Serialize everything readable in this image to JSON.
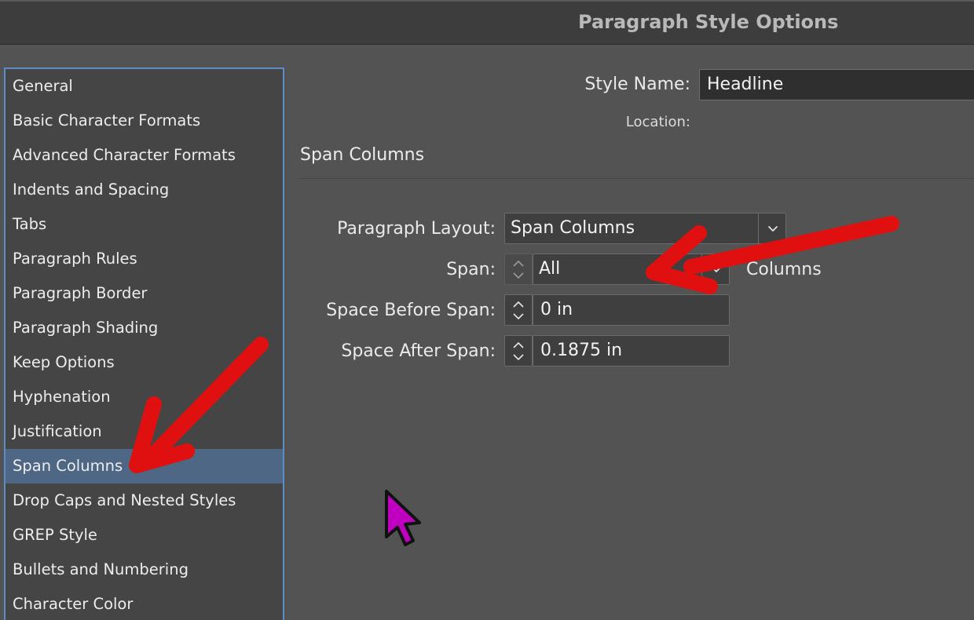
{
  "window": {
    "title": "Paragraph Style Options"
  },
  "sidebar": {
    "items": [
      {
        "label": "General"
      },
      {
        "label": "Basic Character Formats"
      },
      {
        "label": "Advanced Character Formats"
      },
      {
        "label": "Indents and Spacing"
      },
      {
        "label": "Tabs"
      },
      {
        "label": "Paragraph Rules"
      },
      {
        "label": "Paragraph Border"
      },
      {
        "label": "Paragraph Shading"
      },
      {
        "label": "Keep Options"
      },
      {
        "label": "Hyphenation"
      },
      {
        "label": "Justification"
      },
      {
        "label": "Span Columns",
        "selected": true
      },
      {
        "label": "Drop Caps and Nested Styles"
      },
      {
        "label": "GREP Style"
      },
      {
        "label": "Bullets and Numbering"
      },
      {
        "label": "Character Color"
      }
    ]
  },
  "header": {
    "style_name_label": "Style Name:",
    "style_name_value": "Headline",
    "location_label": "Location:"
  },
  "section": {
    "title": "Span Columns"
  },
  "form": {
    "paragraph_layout": {
      "label": "Paragraph Layout:",
      "value": "Span Columns"
    },
    "span": {
      "label": "Span:",
      "value": "All",
      "suffix": "Columns"
    },
    "space_before": {
      "label": "Space Before Span:",
      "value": "0 in"
    },
    "space_after": {
      "label": "Space After Span:",
      "value": "0.1875 in"
    }
  },
  "colors": {
    "background": "#535353",
    "titlebar": "#3d3d3d",
    "selection": "#4d6785",
    "focus_border": "#5b8dc9",
    "annotation_arrow": "#e01010",
    "cursor": "#c000c0"
  },
  "icons": {
    "dropdown": "chevron-down-icon",
    "stepper": "up-down-stepper-icon",
    "annotation": "red-arrow-icon",
    "pointer": "mouse-cursor-icon"
  }
}
